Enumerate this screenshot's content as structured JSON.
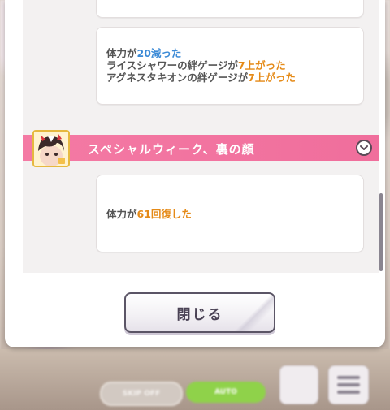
{
  "event_log": {
    "card1": {
      "lines": [
        {
          "prefix": "体力が",
          "value": "20減った",
          "suffix": "",
          "color": "#3b8ad6"
        },
        {
          "prefix": "ライスシャワーの絆ゲージが",
          "value": "7上がった",
          "suffix": "",
          "color": "#e58a17"
        },
        {
          "prefix": "アグネスタキオンの絆ゲージが",
          "value": "7上がった",
          "suffix": "",
          "color": "#e58a17"
        }
      ]
    },
    "event2": {
      "title": "スペシャルウィーク、裏の顔",
      "card_line": {
        "prefix": "体力が",
        "value": "61回復した",
        "color": "#e58a17"
      }
    }
  },
  "dialog": {
    "close_label": "閉じる"
  },
  "bottom_bar": {
    "skip_label": "SKIP OFF",
    "auto_label": "AUTO"
  },
  "colors": {
    "event_header": "#f06e9c",
    "decrease": "#3b8ad6",
    "increase": "#e58a17"
  }
}
